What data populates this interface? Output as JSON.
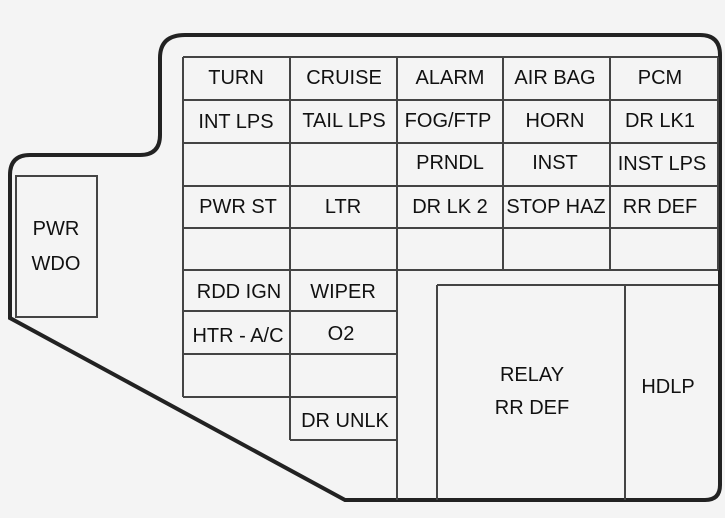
{
  "diagram": {
    "side_block": {
      "line1": "PWR",
      "line2": "WDO"
    },
    "fuses": {
      "r1": [
        "TURN",
        "CRUISE",
        "ALARM",
        "AIR BAG",
        "PCM"
      ],
      "r2": [
        "INT LPS",
        "TAIL LPS",
        "FOG/FTP",
        "HORN",
        "DR LK1"
      ],
      "r3": [
        "",
        "",
        "PRNDL",
        "INST",
        "INST LPS"
      ],
      "r4": [
        "PWR ST",
        "LTR",
        "DR LK 2",
        "STOP HAZ",
        "RR DEF"
      ],
      "lower": [
        "RDD IGN",
        "WIPER",
        "HTR - A/C",
        "O2",
        "DR UNLK"
      ]
    },
    "relay": {
      "line1": "RELAY",
      "line2": "RR DEF"
    },
    "hdlp": "HDLP"
  }
}
